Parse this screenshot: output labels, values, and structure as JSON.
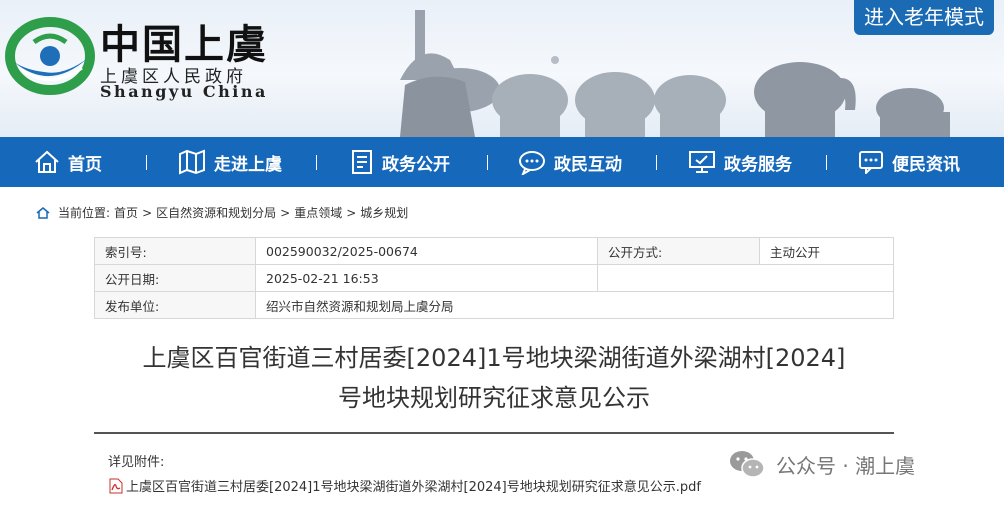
{
  "header": {
    "site_title": "中国上虞",
    "site_subtitle": "上虞区人民政府",
    "site_english": "Shangyu China",
    "elder_mode_button": "进入老年模式"
  },
  "nav": {
    "items": [
      {
        "label": "首页",
        "icon": "home-icon"
      },
      {
        "label": "走进上虞",
        "icon": "map-icon"
      },
      {
        "label": "政务公开",
        "icon": "document-icon"
      },
      {
        "label": "政民互动",
        "icon": "chat-icon"
      },
      {
        "label": "政务服务",
        "icon": "monitor-icon"
      },
      {
        "label": "便民资讯",
        "icon": "message-icon"
      }
    ]
  },
  "breadcrumb": {
    "prefix": "当前位置:",
    "items": [
      "首页",
      "区自然资源和规划分局",
      "重点领域",
      "城乡规划"
    ],
    "separator": ">"
  },
  "info": {
    "index_label": "索引号:",
    "index_value": "002590032/2025-00674",
    "public_method_label": "公开方式:",
    "public_method_value": "主动公开",
    "date_label": "公开日期:",
    "date_value": "2025-02-21 16:53",
    "publisher_label": "发布单位:",
    "publisher_value": "绍兴市自然资源和规划局上虞分局"
  },
  "document": {
    "title_line1": "上虞区百官街道三村居委[2024]1号地块梁湖街道外梁湖村[2024]",
    "title_line2": "号地块规划研究征求意见公示",
    "attachments_label": "详见附件:",
    "attachment_name": "上虞区百官街道三村居委[2024]1号地块梁湖街道外梁湖村[2024]号地块规划研究征求意见公示.pdf"
  },
  "watermark": {
    "text": "公众号 · 潮上虞"
  },
  "colors": {
    "nav_blue": "#1668ba",
    "elder_button_blue": "#1a6bb3",
    "logo_green": "#2e9e4a",
    "logo_blue": "#1f6fb8"
  }
}
